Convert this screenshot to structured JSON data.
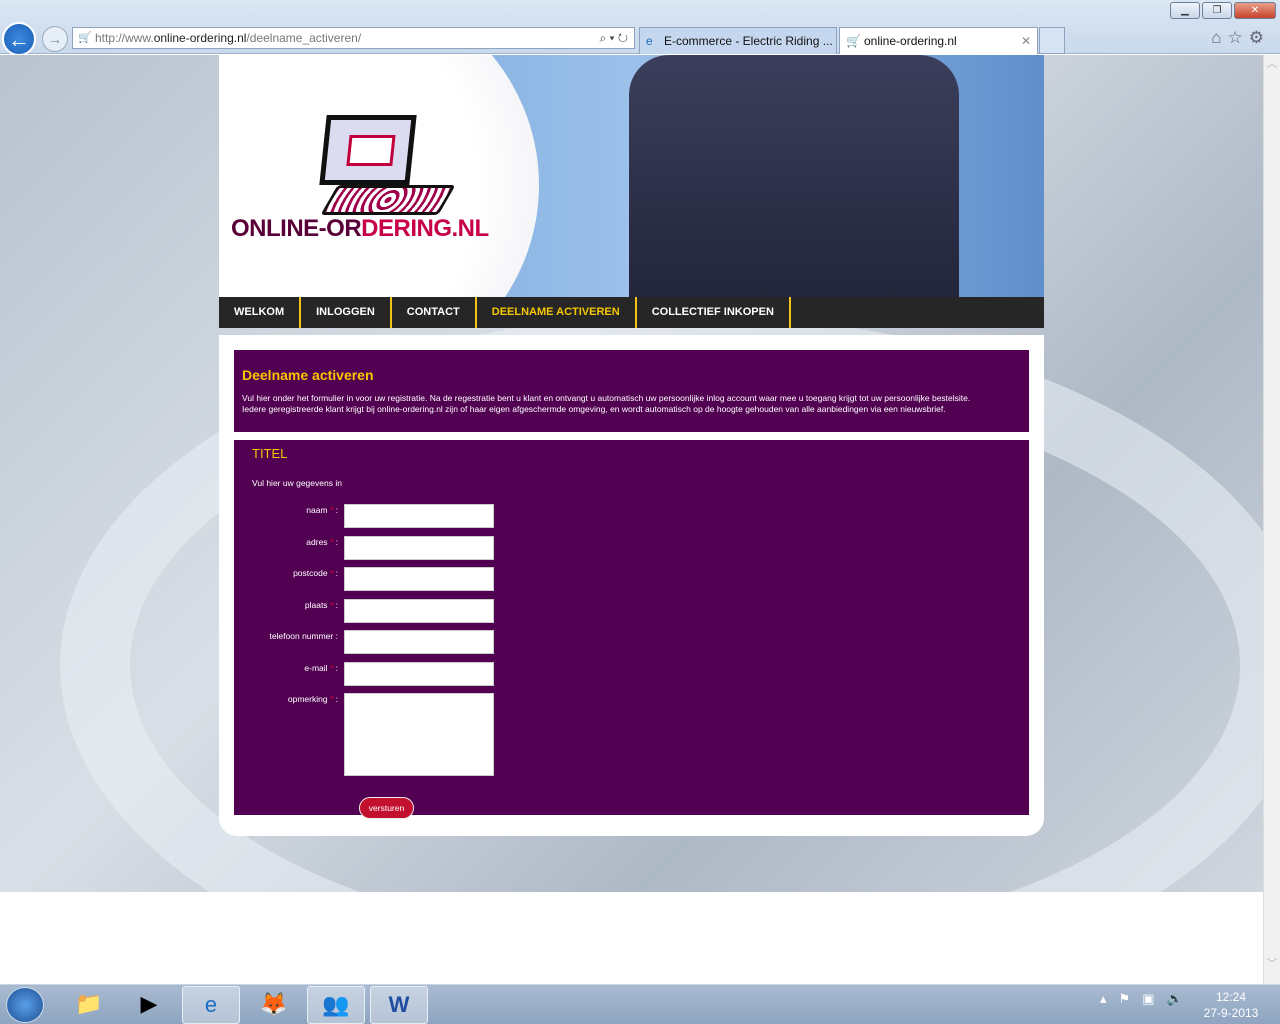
{
  "browser": {
    "url_prefix": "http://www.",
    "url_domain": "online-ordering.nl",
    "url_path": "/deelname_activeren/",
    "tabs": [
      {
        "label": "E-commerce - Electric Riding ...",
        "icon": "ie-icon"
      },
      {
        "label": "online-ordering.nl",
        "icon": "cart-icon"
      }
    ]
  },
  "site": {
    "logo_part1": "ONLINE-OR",
    "logo_part2": "DERING.NL",
    "nav": [
      {
        "label": "WELKOM"
      },
      {
        "label": "INLOGGEN"
      },
      {
        "label": "CONTACT"
      },
      {
        "label": "DEELNAME ACTIVEREN",
        "active": true
      },
      {
        "label": "COLLECTIEF INKOPEN"
      }
    ],
    "intro": {
      "title": "Deelname activeren",
      "text1": "Vul hier onder het formulier in voor uw registratie. Na de regestratie bent u klant en ontvangt u automatisch uw persoonlijke inlog account waar mee u toegang krijgt tot uw persoonlijke bestelsite.",
      "text2": "Iedere geregistreerde klant krijgt bij online-ordering.nl zijn of haar eigen afgeschermde omgeving, en wordt automatisch op de hoogte gehouden van alle aanbiedingen via een nieuwsbrief."
    },
    "form": {
      "title": "TITEL",
      "subtitle": "Vul hier uw gegevens in",
      "fields": [
        {
          "label": "naam",
          "required": "*",
          "colon": ":"
        },
        {
          "label": "adres",
          "required": "*",
          "colon": ":"
        },
        {
          "label": "postcode",
          "required": "*",
          "colon": ":"
        },
        {
          "label": "plaats",
          "required": "*",
          "colon": ":"
        },
        {
          "label": "telefoon nummer",
          "required": "",
          "colon": ":"
        },
        {
          "label": "e-mail",
          "required": "*",
          "colon": ":"
        },
        {
          "label": "opmerking",
          "required": "*",
          "colon": ":"
        }
      ],
      "submit": "versturen"
    }
  },
  "taskbar": {
    "time": "12:24",
    "date": "27-9-2013"
  },
  "colors": {
    "purple": "#520052",
    "accent": "#f7c600",
    "button": "#c4102f"
  }
}
